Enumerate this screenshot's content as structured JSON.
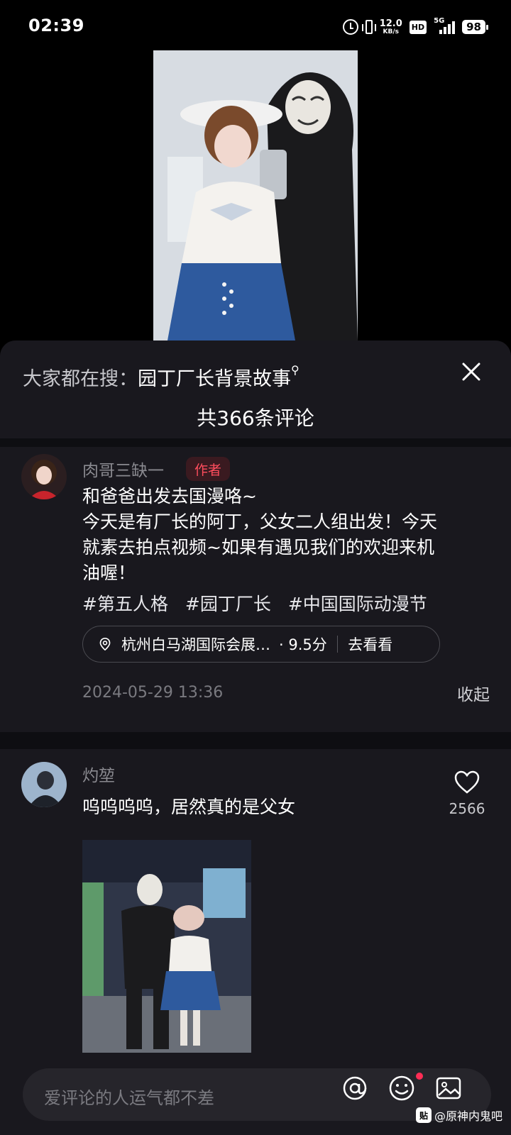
{
  "status_bar": {
    "time": "02:39",
    "net_speed_value": "12.0",
    "net_speed_unit": "KB/s",
    "hd": "HD",
    "network": "5G",
    "battery": "98"
  },
  "sheet": {
    "search_hint_prefix": "大家都在搜：",
    "search_hint_keyword": "园丁厂长背景故事",
    "comment_count_title": "共366条评论"
  },
  "author_comment": {
    "nickname": "肉哥三缺一",
    "tag": "作者",
    "lines": [
      "和爸爸出发去国漫咯~",
      "今天是有厂长的阿丁，父女二人组出发！今天",
      "就素去拍点视频~如果有遇见我们的欢迎来机",
      "油喔！"
    ],
    "hashtags": [
      "#第五人格",
      "#园丁厂长",
      "#中国国际动漫节"
    ],
    "location": {
      "name": "杭州白马湖国际会展…",
      "score": "· 9.5分",
      "action": "去看看"
    },
    "timestamp": "2024-05-29 13:36",
    "collapse": "收起"
  },
  "reply_comment": {
    "nickname": "灼堃",
    "text": "呜呜呜呜，居然真的是父女",
    "likes": "2566"
  },
  "input": {
    "placeholder": "爱评论的人运气都不差"
  },
  "watermark": {
    "logo": "贴",
    "text": "@原神内鬼吧"
  },
  "icons": {
    "close": "close-icon",
    "location": "location-pin-icon",
    "like": "heart-icon",
    "mention": "at-icon",
    "emoji": "emoji-icon",
    "image": "image-icon"
  },
  "colors": {
    "sheet_bg": "#19181e",
    "author_tag_text": "#ff4d5d",
    "author_tag_bg": "#3a1a20",
    "muted_text": "#8a8a90",
    "notification_dot": "#ff2d55"
  }
}
